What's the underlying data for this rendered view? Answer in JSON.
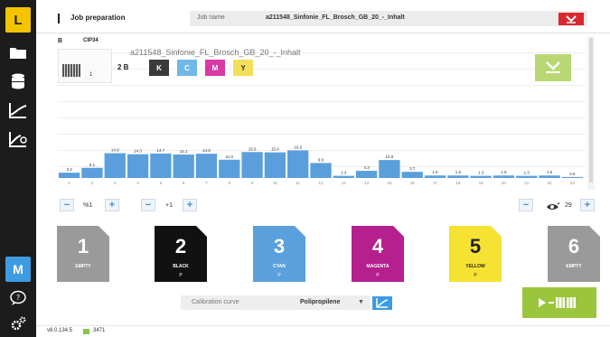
{
  "sidebar": {
    "top_label": "L",
    "items": [
      {
        "icon": "folder-icon"
      },
      {
        "icon": "database-icon"
      },
      {
        "icon": "curve-icon"
      },
      {
        "icon": "curve-edit-icon"
      }
    ],
    "mode_label": "M",
    "bottom_items": [
      {
        "icon": "help-icon"
      },
      {
        "icon": "settings-icon"
      }
    ]
  },
  "header": {
    "title": "Job preparation",
    "job_name_label": "Job name",
    "job_name_value": "a211548_Sinfonie_FL_Brosch_GB_20_-_Inhalt"
  },
  "preview": {
    "tag_b": "B",
    "tag_cip": "CIP34",
    "file_name": "a211548_Sinfonie_FL_Brosch_GB_20_-_Inhalt",
    "thumb_page": "1",
    "page_label": "2 B",
    "inks": [
      {
        "label": "K",
        "color": "#3a3a3a",
        "text_color": "#ffffff"
      },
      {
        "label": "C",
        "color": "#6fb8e8",
        "text_color": "#ffffff"
      },
      {
        "label": "M",
        "color": "#d83aa3",
        "text_color": "#ffffff"
      },
      {
        "label": "Y",
        "color": "#f2df5a",
        "text_color": "#333333"
      }
    ]
  },
  "chart_data": {
    "type": "bar",
    "categories": [
      "1",
      "2",
      "3",
      "4",
      "5",
      "6",
      "7",
      "8",
      "9",
      "10",
      "11",
      "12",
      "13",
      "14",
      "15",
      "16",
      "17",
      "18",
      "19",
      "20",
      "21",
      "22",
      "23"
    ],
    "values": [
      3.2,
      6.1,
      14.9,
      14.3,
      14.7,
      14.1,
      14.6,
      11.0,
      15.6,
      15.4,
      16.6,
      9.0,
      1.3,
      4.3,
      10.8,
      3.7,
      1.5,
      1.5,
      1.3,
      1.5,
      1.3,
      1.5,
      0.6
    ],
    "labels": [
      "3.2",
      "6.1",
      "14.9",
      "14.3",
      "14.7",
      "14.1",
      "14.6",
      "11.0",
      "15.6",
      "15.4",
      "16.6",
      "9.0",
      "1.3",
      "4.3",
      "10.8",
      "3.7",
      "1.5",
      "1.5",
      "1.3",
      "1.5",
      "1.3",
      "1.5",
      "0.6"
    ],
    "ylim": [
      0,
      50
    ],
    "bar_color": "#5a9fdc",
    "grid": true
  },
  "controls": {
    "left_value": "%1",
    "mid_value": "+1",
    "right_value": "29"
  },
  "channels": [
    {
      "number": "1",
      "label": "EMPTY",
      "sub": "",
      "bg": "#9a9a9a",
      "fg": "#ffffff"
    },
    {
      "number": "2",
      "label": "BLACK",
      "sub": "P",
      "bg": "#111111",
      "fg": "#ffffff"
    },
    {
      "number": "3",
      "label": "CYAN",
      "sub": "P",
      "bg": "#5aa0dc",
      "fg": "#ffffff"
    },
    {
      "number": "4",
      "label": "MAGENTA",
      "sub": "P",
      "bg": "#b51f8e",
      "fg": "#ffffff"
    },
    {
      "number": "5",
      "label": "YELLOW",
      "sub": "P",
      "bg": "#f5e233",
      "fg": "#222222"
    },
    {
      "number": "6",
      "label": "EMPTY",
      "sub": "",
      "bg": "#9a9a9a",
      "fg": "#ffffff"
    }
  ],
  "calibration": {
    "label": "Calibration curve",
    "value": "Polipropilene"
  },
  "footer": {
    "version": "v8.0.134.5",
    "count": "3471"
  },
  "colors": {
    "accent_yellow": "#f5c400",
    "accent_blue": "#3d9be2",
    "accent_green": "#9bc53d",
    "danger": "#d9272e"
  }
}
